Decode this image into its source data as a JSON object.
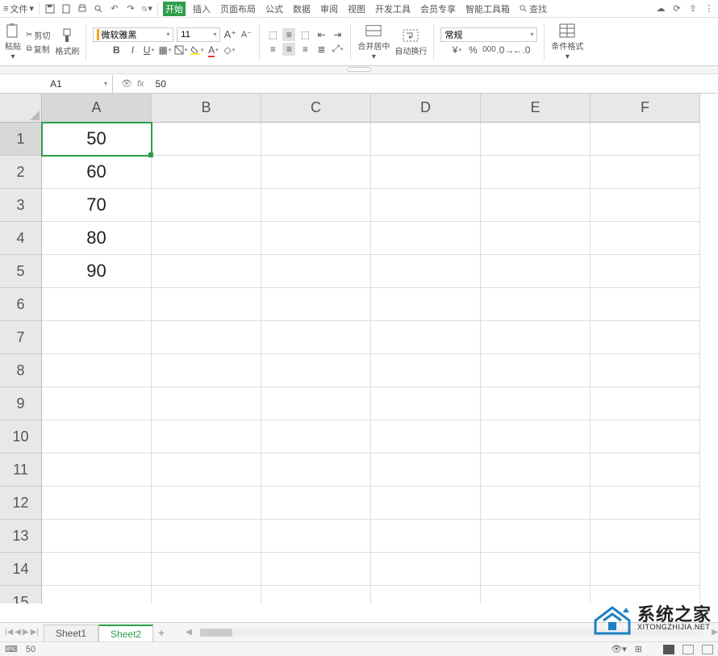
{
  "qat": {
    "file_label": "文件"
  },
  "tabs": {
    "start": "开始",
    "insert": "插入",
    "layout": "页面布局",
    "formula": "公式",
    "data": "数据",
    "review": "审阅",
    "view": "视图",
    "dev": "开发工具",
    "member": "会员专享",
    "toolbox": "智能工具箱",
    "search": "查找"
  },
  "ribbon": {
    "paste": "粘贴",
    "cut": "剪切",
    "copy": "复制",
    "format_painter": "格式刷",
    "font_name": "微软雅黑",
    "font_size": "11",
    "merge_center": "合并居中",
    "wrap_text": "自动换行",
    "number_format": "常规",
    "cond_format": "条件格式"
  },
  "namebox": "A1",
  "formula_value": "50",
  "columns": [
    "A",
    "B",
    "C",
    "D",
    "E",
    "F"
  ],
  "rows": [
    "1",
    "2",
    "3",
    "4",
    "5",
    "6",
    "7",
    "8",
    "9",
    "10",
    "11",
    "12",
    "13",
    "14",
    "15"
  ],
  "cell_data": {
    "A1": "50",
    "A2": "60",
    "A3": "70",
    "A4": "80",
    "A5": "90"
  },
  "active_cell": "A1",
  "sheets": {
    "s1": "Sheet1",
    "s2": "Sheet2"
  },
  "status_value": "50",
  "watermark": {
    "cn": "系统之家",
    "en": "XITONGZHIJIA.NET"
  }
}
